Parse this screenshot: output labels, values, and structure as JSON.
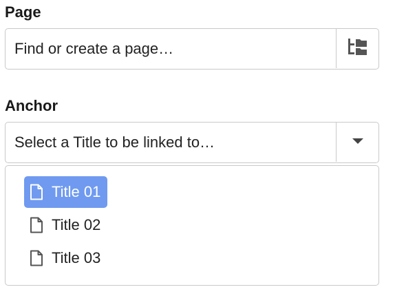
{
  "page_field": {
    "label": "Page",
    "placeholder": "Find or create a page…",
    "browse_icon": "sitemap-folder-icon"
  },
  "anchor_field": {
    "label": "Anchor",
    "placeholder": "Select a Title to be linked to…",
    "toggle_icon": "caret-down-icon",
    "options": [
      {
        "label": "Title 01",
        "icon": "document-icon",
        "selected": true
      },
      {
        "label": "Title 02",
        "icon": "document-icon",
        "selected": false
      },
      {
        "label": "Title 03",
        "icon": "document-icon",
        "selected": false
      }
    ]
  },
  "colors": {
    "selected_background": "#6f9af0",
    "border": "#c9c9c9",
    "icon": "#555555"
  }
}
